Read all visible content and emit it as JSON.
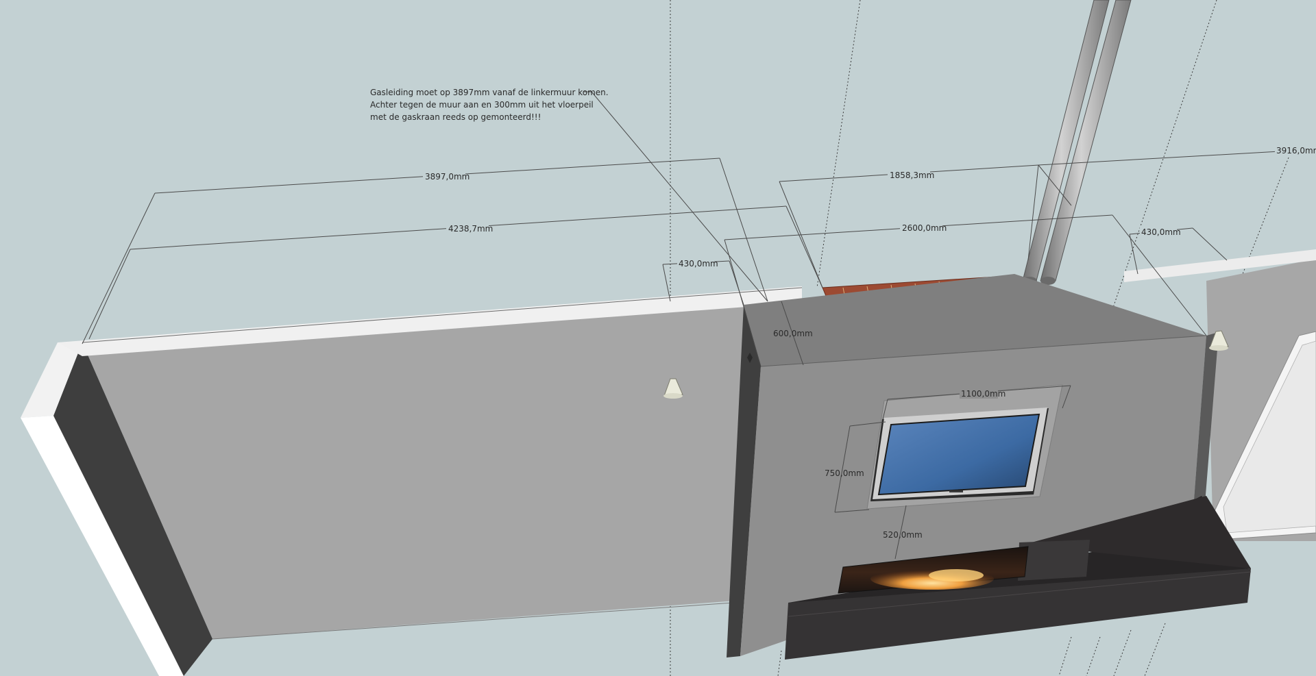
{
  "annotation": {
    "line1": "Gasleiding moet op 3897mm vanaf de linkermuur komen.",
    "line2": "Achter tegen de muur aan en 300mm uit het vloerpeil",
    "line3": "met de gaskraan reeds op gemonteerd!!!"
  },
  "dimensions": {
    "d3897": "3897,0mm",
    "d4238": "4238,7mm",
    "d1858": "1858,3mm",
    "d2600": "2600,0mm",
    "d3916": "3916,0mm",
    "d430a": "430,0mm",
    "d430b": "430,0mm",
    "d600": "600,0mm",
    "d1100": "1100,0mm",
    "d750": "750,0mm",
    "d520": "520,0mm"
  },
  "colors": {
    "sky": "#c3d1d3",
    "wall_front": "#a6a6a6",
    "wall_side": "#3e3e3e",
    "chimney_front": "#8f8f8f",
    "chimney_top": "#7f7f7f",
    "hearth": "#2e2b2c",
    "tv_screen": "#3f6fa8",
    "brick": "#9c4a32"
  }
}
